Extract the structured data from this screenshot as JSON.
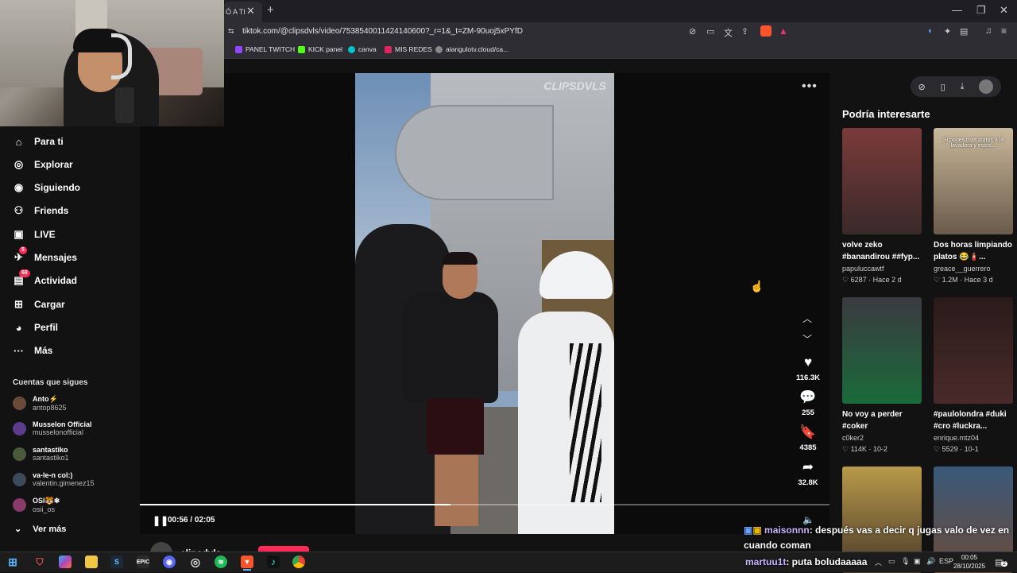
{
  "browser": {
    "tab_label": "Ó A TI",
    "url": "tiktok.com/@clipsdvls/video/7538540011424140600?_r=1&_t=ZM-90uoj5xPYfD",
    "bookmarks": [
      {
        "label": "PANEL TWITCH",
        "color": "#9146ff"
      },
      {
        "label": "KICK panel",
        "color": "#53fc18"
      },
      {
        "label": "canva",
        "color": "#00c4cc"
      },
      {
        "label": "MIS REDES",
        "color": "#e0245e"
      },
      {
        "label": "alangulotv.cloud/ca...",
        "color": "#888888"
      }
    ]
  },
  "sidebar": {
    "nav": [
      {
        "label": "Para ti",
        "icon": "home-icon",
        "glyph": "⌂"
      },
      {
        "label": "Explorar",
        "icon": "compass-icon",
        "glyph": "◎"
      },
      {
        "label": "Siguiendo",
        "icon": "following-avatar-icon",
        "glyph": "◉"
      },
      {
        "label": "Friends",
        "icon": "friends-icon",
        "glyph": "⚇"
      },
      {
        "label": "LIVE",
        "icon": "live-icon",
        "glyph": "▣"
      },
      {
        "label": "Mensajes",
        "icon": "messages-icon",
        "glyph": "✈",
        "badge": "5"
      },
      {
        "label": "Actividad",
        "icon": "activity-icon",
        "glyph": "▤",
        "badge": "68"
      },
      {
        "label": "Cargar",
        "icon": "upload-icon",
        "glyph": "⊞"
      },
      {
        "label": "Perfil",
        "icon": "profile-icon",
        "glyph": "◕"
      },
      {
        "label": "Más",
        "icon": "more-icon",
        "glyph": "···"
      }
    ],
    "following_title": "Cuentas que sigues",
    "accounts": [
      {
        "name": "Anto⚡",
        "handle": "antop8625",
        "color": "#6b4a3a"
      },
      {
        "name": "Musselon Official",
        "handle": "musselonofficial",
        "color": "#5a3d8a"
      },
      {
        "name": "santastiko",
        "handle": "santastiko1",
        "color": "#4a5a3a"
      },
      {
        "name": "va-le-n col:)",
        "handle": "valentin.gimenez15",
        "color": "#3a4a5a"
      },
      {
        "name": "OSI🐯❄",
        "handle": "osii_os",
        "color": "#8a3a6a"
      }
    ],
    "see_more": "Ver más"
  },
  "player": {
    "watermark": "CLIPSDVLS",
    "time": "00:56 / 02:05",
    "progress": 0.45,
    "author": "clipsdvls",
    "actions": [
      {
        "icon": "heart-icon",
        "glyph": "♥",
        "count": "116.3K"
      },
      {
        "icon": "comment-icon",
        "glyph": "💬",
        "count": "255"
      },
      {
        "icon": "bookmark-icon",
        "glyph": "🔖",
        "count": "4385"
      },
      {
        "icon": "share-icon",
        "glyph": "➦",
        "count": "32.8K"
      }
    ]
  },
  "recommendations": {
    "title": "Podría interesarte",
    "cards": [
      {
        "title": "volve zeko #banandirou ##fyp...",
        "user": "papuluccawtf",
        "likes": "6287",
        "when": "Hace 2 d",
        "thumb": [
          "#7a3a3a",
          "#3a2a2a"
        ]
      },
      {
        "title": "Dos horas limpiando platos 😂🧯...",
        "user": "greace__guerrero",
        "likes": "1.2M",
        "when": "Hace 3 d",
        "thumb": [
          "#c9b89a",
          "#6a5a4a"
        ],
        "overlay": "Si pones mas platos a la lavadora y estos..."
      },
      {
        "title": "No voy a perder #coker",
        "user": "c0ker2",
        "likes": "114K",
        "when": "10-2",
        "thumb": [
          "#3a3a40",
          "#1a6a3a"
        ]
      },
      {
        "title": "#paulolondra #duki #cro #luckra...",
        "user": "enrique.mtz04",
        "likes": "5529",
        "when": "10-1",
        "thumb": [
          "#2a1a1a",
          "#4a2a2a"
        ]
      },
      {
        "title": "",
        "user": "",
        "likes": "",
        "when": "",
        "thumb": [
          "#b89a4a",
          "#4a3a2a"
        ]
      },
      {
        "title": "",
        "user": "",
        "likes": "",
        "when": "",
        "thumb": [
          "#3a5a7a",
          "#6a4a3a"
        ]
      }
    ]
  },
  "chat": [
    {
      "user": "maisonnn",
      "message": ": después vas a decir q jugas valo de vez en cuando coman"
    },
    {
      "user": "martuu1t",
      "message": ": puta boludaaaaa"
    }
  ],
  "taskbar": {
    "lang": "ESP",
    "time": "00:05",
    "date": "28/10/2025",
    "notifications": "2"
  }
}
